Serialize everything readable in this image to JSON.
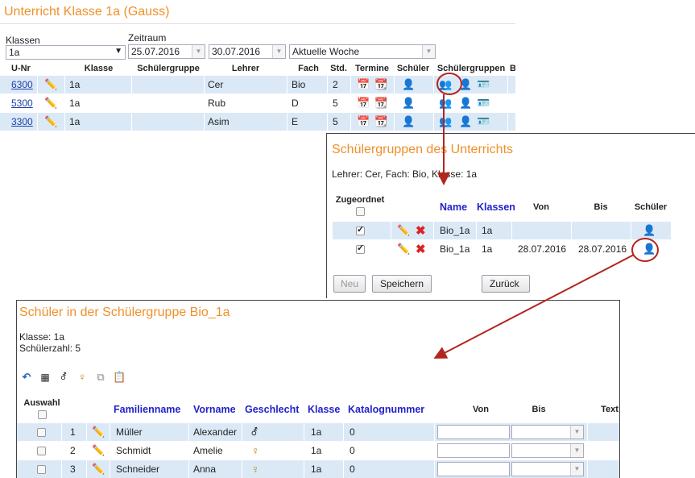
{
  "panel1": {
    "title": "Unterricht Klasse 1a (Gauss)",
    "klassen_label": "Klassen",
    "klassen_value": "1a",
    "zeitraum_label": "Zeitraum",
    "date_from": "25.07.2016",
    "date_to": "30.07.2016",
    "range_select": "Aktuelle Woche",
    "columns": [
      "U-Nr",
      "Klasse",
      "Schülergruppe",
      "Lehrer",
      "Fach",
      "Std.",
      "Termine",
      "Schüler",
      "Schülergruppen",
      "B"
    ],
    "rows": [
      {
        "unr": "6300",
        "klasse": "1a",
        "gruppe": "",
        "lehrer": "Cer",
        "fach": "Bio",
        "std": "2"
      },
      {
        "unr": "5300",
        "klasse": "1a",
        "gruppe": "",
        "lehrer": "Rub",
        "fach": "D",
        "std": "5"
      },
      {
        "unr": "3300",
        "klasse": "1a",
        "gruppe": "",
        "lehrer": "Asim",
        "fach": "E",
        "std": "5"
      }
    ]
  },
  "panel2": {
    "title": "Schülergruppen des Unterrichts",
    "subtitle": "Lehrer: Cer, Fach: Bio, Klasse: 1a",
    "col_zugeordnet": "Zugeordnet",
    "col_name": "Name",
    "col_klassen": "Klassen",
    "col_von": "Von",
    "col_bis": "Bis",
    "col_schueler": "Schüler",
    "rows": [
      {
        "name": "Bio_1a",
        "klasse": "1a",
        "von": "",
        "bis": ""
      },
      {
        "name": "Bio_1a",
        "klasse": "1a",
        "von": "28.07.2016",
        "bis": "28.07.2016"
      }
    ],
    "btn_neu": "Neu",
    "btn_speichern": "Speichern",
    "btn_zurueck": "Zurück"
  },
  "panel3": {
    "title": "Schüler in der Schülergruppe Bio_1a",
    "klasse_line": "Klasse: 1a",
    "zahl_line": "Schülerzahl: 5",
    "col_auswahl": "Auswahl",
    "col_familienname": "Familienname",
    "col_vorname": "Vorname",
    "col_geschlecht": "Geschlecht",
    "col_klasse": "Klasse",
    "col_katalog": "Katalognummer",
    "col_von": "Von",
    "col_bis": "Bis",
    "col_text": "Text",
    "rows": [
      {
        "nr": "1",
        "familienname": "Müller",
        "vorname": "Alexander",
        "geschlecht_icon": "male-icon",
        "klasse": "1a",
        "katalog": "0"
      },
      {
        "nr": "2",
        "familienname": "Schmidt",
        "vorname": "Amelie",
        "geschlecht_icon": "female-icon",
        "klasse": "1a",
        "katalog": "0"
      },
      {
        "nr": "3",
        "familienname": "Schneider",
        "vorname": "Anna",
        "geschlecht_icon": "female-icon",
        "klasse": "1a",
        "katalog": "0"
      }
    ]
  },
  "colors": {
    "title_orange": "#f0902a",
    "header_blue": "#2222cc",
    "row_blue": "#dbe9f7",
    "annotation_red": "#b3261e"
  }
}
